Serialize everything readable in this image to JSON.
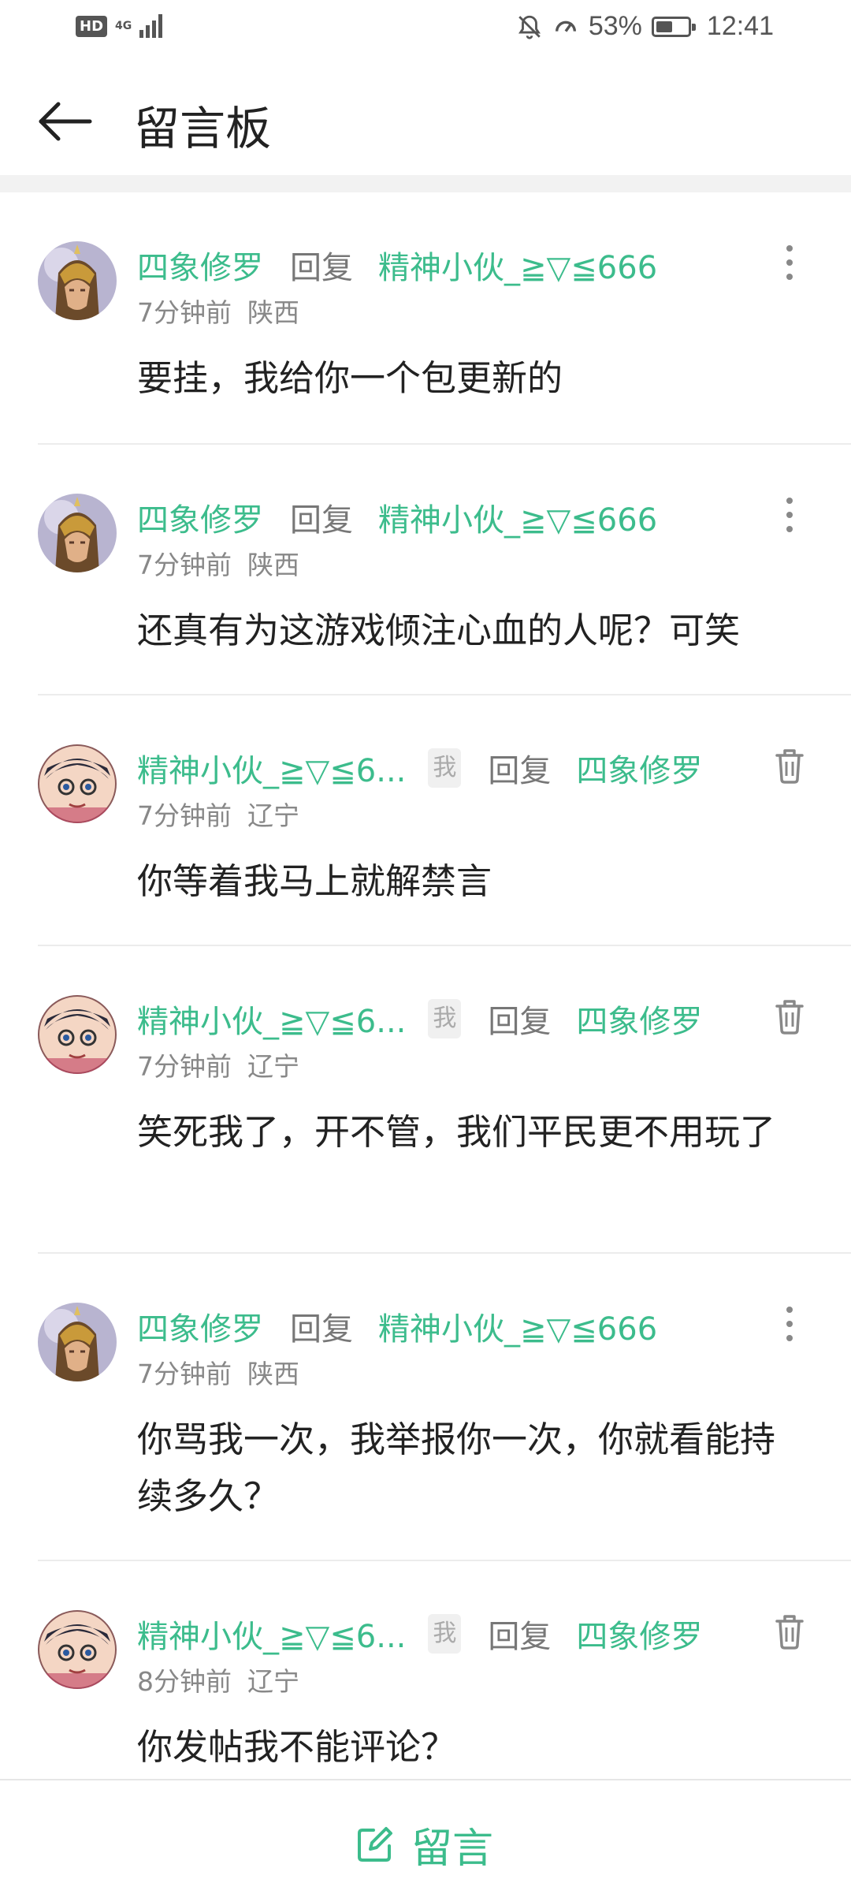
{
  "status_bar": {
    "hd": "HD",
    "network": "4G",
    "battery_percent": "53%",
    "battery_level": 0.53,
    "time": "12:41",
    "icons": [
      "mute-bell-icon",
      "data-saver-icon",
      "battery-icon",
      "signal-icon"
    ]
  },
  "header": {
    "title": "留言板",
    "back_icon": "arrow-left-icon"
  },
  "comments": [
    {
      "author": "四象修罗",
      "reply_word": "回复",
      "reply_to": "精神小伙_≧▽≦666",
      "time": "7分钟前",
      "region": "陕西",
      "text": "要挂，我给你一个包更新的",
      "action_icon": "more-vertical-icon"
    },
    {
      "author": "四象修罗",
      "reply_word": "回复",
      "reply_to": "精神小伙_≧▽≦666",
      "time": "7分钟前",
      "region": "陕西",
      "text": "还真有为这游戏倾注心血的人呢？可笑",
      "action_icon": "more-vertical-icon"
    },
    {
      "author": "精神小伙_≧▽≦6...",
      "badge": "我",
      "reply_word": "回复",
      "reply_to": "四象修罗",
      "time": "7分钟前",
      "region": "辽宁",
      "text": "你等着我马上就解禁言",
      "action_icon": "trash-icon"
    },
    {
      "author": "精神小伙_≧▽≦6...",
      "badge": "我",
      "reply_word": "回复",
      "reply_to": "四象修罗",
      "time": "7分钟前",
      "region": "辽宁",
      "text": "笑死我了，开不管，我们平民更不用玩了",
      "action_icon": "trash-icon"
    },
    {
      "author": "四象修罗",
      "reply_word": "回复",
      "reply_to": "精神小伙_≧▽≦666",
      "time": "7分钟前",
      "region": "陕西",
      "text": "你骂我一次，我举报你一次，你就看能持续多久？",
      "action_icon": "more-vertical-icon"
    },
    {
      "author": "精神小伙_≧▽≦6...",
      "badge": "我",
      "reply_word": "回复",
      "reply_to": "四象修罗",
      "time": "8分钟前",
      "region": "辽宁",
      "text": "你发帖我不能评论？",
      "action_icon": "trash-icon"
    }
  ],
  "bottom_bar": {
    "label": "留言",
    "icon": "edit-icon"
  },
  "colors": {
    "accent": "#3cbc8c",
    "divider": "#ececec",
    "band": "#f2f2f2"
  }
}
